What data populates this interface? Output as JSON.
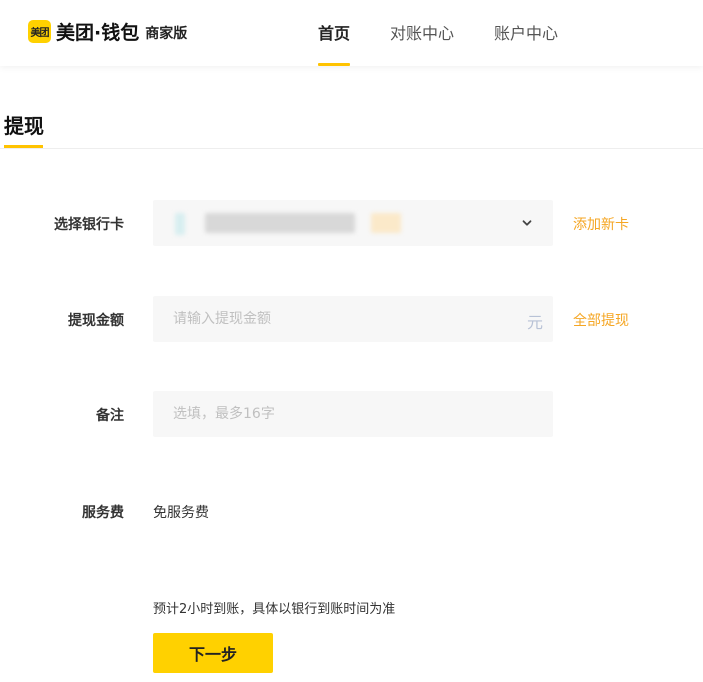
{
  "header": {
    "logo_mark": "美团",
    "logo_text": "美团·钱包",
    "logo_sub": "商家版",
    "nav": [
      {
        "label": "首页",
        "active": true
      },
      {
        "label": "对账中心",
        "active": false
      },
      {
        "label": "账户中心",
        "active": false
      }
    ]
  },
  "page": {
    "title": "提现"
  },
  "form": {
    "bank_card": {
      "label": "选择银行卡",
      "value": "",
      "link": "添加新卡"
    },
    "amount": {
      "label": "提现金额",
      "value": "",
      "placeholder": "请输入提现金额",
      "unit": "元",
      "link": "全部提现"
    },
    "remark": {
      "label": "备注",
      "value": "",
      "placeholder": "选填，最多16字"
    },
    "fee": {
      "label": "服务费",
      "value": "免服务费"
    },
    "hint": "预计2小时到账，具体以银行到账时间为准",
    "next_button": "下一步"
  },
  "colors": {
    "brand_yellow": "#FFD100",
    "accent_underline": "#FFC300",
    "link_orange": "#F5A623",
    "field_bg": "#F7F7F7"
  },
  "icons": {
    "dropdown": "chevron-down-icon",
    "logo": "meituan-logo-icon"
  }
}
